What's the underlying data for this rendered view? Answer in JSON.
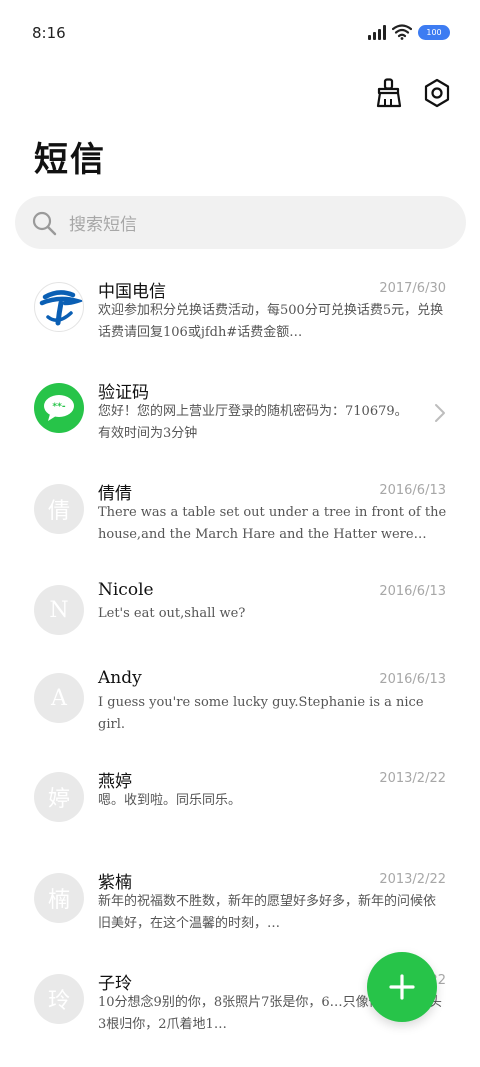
{
  "status_bar": {
    "time": "8:16",
    "battery": "100"
  },
  "header": {
    "title": "短信",
    "clean_icon": "broom-icon",
    "settings_icon": "gear-icon"
  },
  "search": {
    "placeholder": "搜索短信"
  },
  "colors": {
    "accent_green": "#27c449",
    "telecom_blue": "#0a5fb4",
    "avatar_gray": "#e9e9e9"
  },
  "messages": [
    {
      "name": "中国电信",
      "date": "2017/6/30",
      "preview": "欢迎参加积分兑换话费活动，每500分可兑换话费5元，兑换话费请回复106或jfdh#话费金额…",
      "avatar": "telecom-logo"
    },
    {
      "name": "验证码",
      "date": "",
      "preview": "您好！您的网上营业厅登录的随机密码为：710679。有效时间为3分钟",
      "avatar": "sms-bubble"
    },
    {
      "name": "倩倩",
      "date": "2016/6/13",
      "preview": "There was a table set out under a tree in front of the house,and the March Hare and the Hatter were having…",
      "avatar_letter": "倩"
    },
    {
      "name": "Nicole",
      "date": "2016/6/13",
      "preview": "Let's eat out,shall we?",
      "avatar_letter": "N"
    },
    {
      "name": "Andy",
      "date": "2016/6/13",
      "preview": "I guess you're some lucky guy.Stephanie is a nice girl.",
      "avatar_letter": "A"
    },
    {
      "name": "燕婷",
      "date": "2013/2/22",
      "preview": "嗯。收到啦。同乐同乐。",
      "avatar_letter": "婷"
    },
    {
      "name": "紫楠",
      "date": "2013/2/22",
      "preview": "新年的祝福数不胜数，新年的愿望好多好多，新年的问候依旧美好，在这个温馨的时刻，…",
      "avatar_letter": "楠"
    },
    {
      "name": "子玲",
      "date": "2013/2/22",
      "preview": "10分想念9别的你，8张照片7张是你，6…只像你，4根骨头3根归你，2爪着地1…",
      "avatar_letter": "玲"
    }
  ],
  "fab": {
    "icon": "plus-icon"
  }
}
